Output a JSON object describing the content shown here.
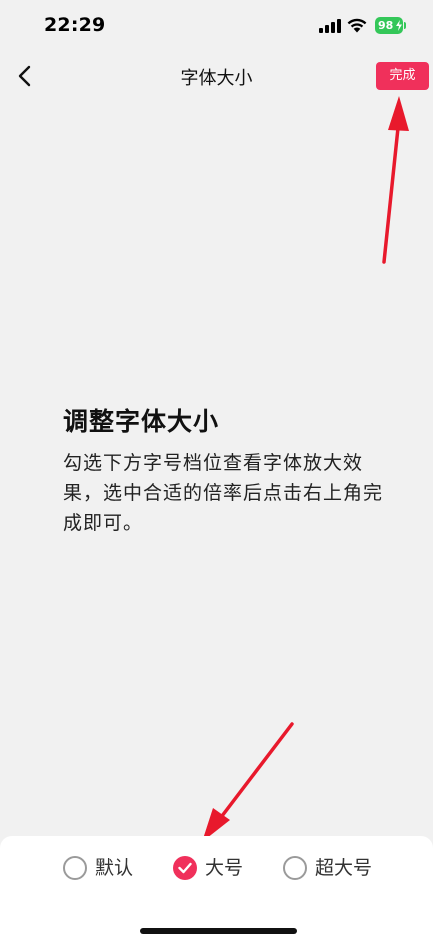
{
  "status_bar": {
    "time": "22:29",
    "battery": "98",
    "battery_color": "#34c759"
  },
  "nav": {
    "back_icon": "chevron-left-icon",
    "title": "字体大小",
    "done_label": "完成",
    "accent_color": "#f0305b"
  },
  "content": {
    "heading": "调整字体大小",
    "description": "勾选下方字号档位查看字体放大效果，选中合适的倍率后点击右上角完成即可。"
  },
  "font_size_options": {
    "selected": "大号",
    "items": [
      {
        "label": "默认",
        "checked": false
      },
      {
        "label": "大号",
        "checked": true
      },
      {
        "label": "超大号",
        "checked": false
      }
    ]
  }
}
